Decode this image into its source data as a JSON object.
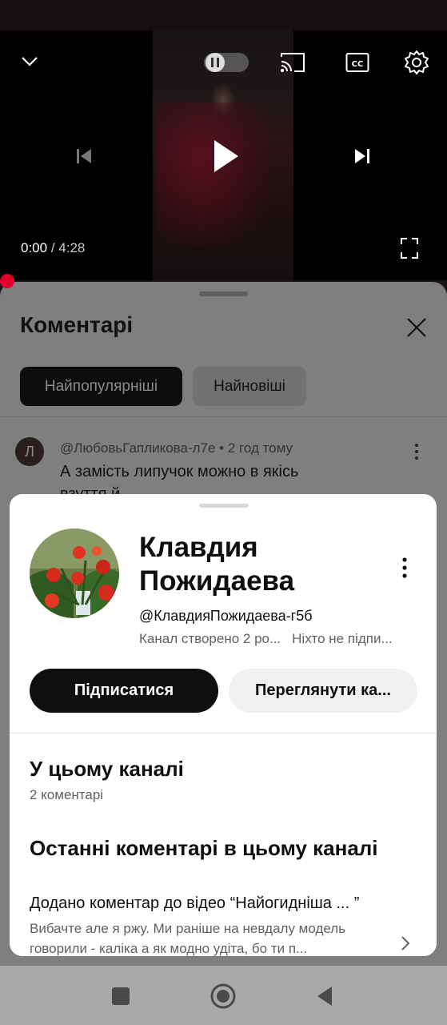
{
  "player": {
    "current_time": "0:00",
    "separator": "/",
    "duration": "4:28",
    "icons": [
      "chevron-down-icon",
      "autoplay-toggle-icon",
      "cast-icon",
      "captions-icon",
      "settings-icon",
      "previous-icon",
      "play-icon",
      "next-icon",
      "fullscreen-icon"
    ]
  },
  "comments": {
    "title": "Коментарі",
    "filters": [
      "Найпопулярніші",
      "Найновіші"
    ],
    "first_comment": {
      "avatar_letter": "Л",
      "author": "@ЛюбовьГапликова-л7е",
      "age": "2 год тому",
      "text": "А замість липучок можно в якісь",
      "text_partial": "взуття й ..."
    }
  },
  "channel_popup": {
    "name_line1": "Клавдия",
    "name_line2": "Пожидаева",
    "handle": "@КлавдияПожидаева-г5б",
    "created": "Канал створено 2 ро...",
    "subscribers": "Ніхто не підпи...",
    "subscribe_label": "Підписатися",
    "view_channel_label": "Переглянути ка...",
    "in_channel_title": "У цьому каналі",
    "comments_count": "2 коментарі",
    "recent_title": "Останні коментарі в цьому каналі",
    "recent_item": {
      "heading": "Додано коментар до відео “Найогидніша ... ”",
      "body": "Вибачте але я ржу. Ми раніше на невдалу модель говорили - каліка а як модно удіта, бо ти п..."
    }
  },
  "nav": {
    "icons": [
      "recent-apps-icon",
      "home-icon",
      "back-icon"
    ]
  },
  "colors": {
    "accent_red": "#e2002a",
    "subscribe_bg": "#0f0f0f",
    "popup_bg": "#ffffff"
  }
}
